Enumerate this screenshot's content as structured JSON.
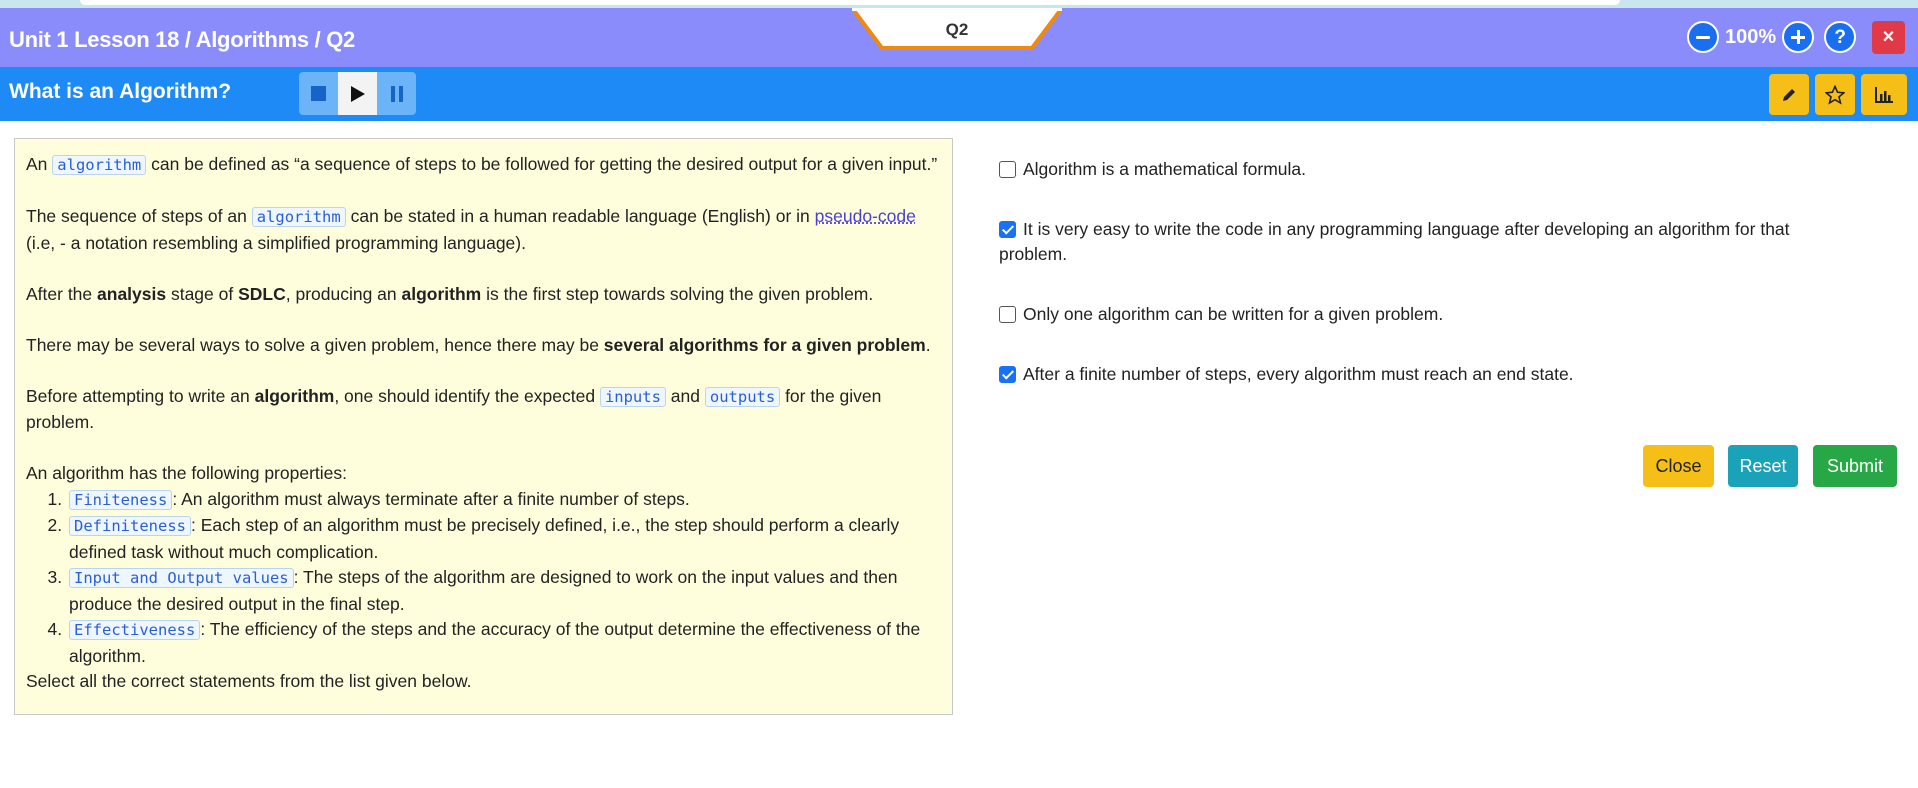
{
  "breadcrumb": "Unit 1 Lesson 18 / Algorithms / Q2",
  "question_tab": "Q2",
  "zoom": {
    "value": "100%",
    "out_icon": "minus-circle-icon",
    "in_icon": "plus-circle-icon"
  },
  "help_label": "?",
  "close_window_label": "×",
  "lesson_title": "What is an Algorithm?",
  "colors": {
    "header_primary": "#8b8cfb",
    "header_secondary": "#1d8af6",
    "tool_button": "#f6bf17",
    "close": "#e03a48",
    "reset": "#1aa2b8",
    "submit": "#27a745"
  },
  "passage": {
    "p1": {
      "before": "An ",
      "code": "algorithm",
      "after": " can be defined as “a sequence of steps to be followed for getting the desired output for a given input.”"
    },
    "p2": {
      "before": "The sequence of steps of an ",
      "code": "algorithm",
      "middle": " can be stated in a human readable language (English) or in ",
      "link": "pseudo-code",
      "after": " (i.e, - a notation resembling a simplified programming language)."
    },
    "p3": {
      "t1": "After the ",
      "b1": "analysis",
      "t2": " stage of ",
      "b2": "SDLC",
      "t3": ", producing an ",
      "b3": "algorithm",
      "t4": " is the first step towards solving the given problem."
    },
    "p4": {
      "t1": "There may be several ways to solve a given problem, hence there may be ",
      "b1": "several algorithms for a given problem",
      "t2": "."
    },
    "p5": {
      "t1": "Before attempting to write an ",
      "b1": "algorithm",
      "t2": ", one should identify the expected ",
      "c1": "inputs",
      "t3": " and ",
      "c2": "outputs",
      "t4": " for the given problem."
    },
    "properties_intro": "An algorithm has the following properties:",
    "properties": [
      {
        "term": "Finiteness",
        "text": ": An algorithm must always terminate after a finite number of steps."
      },
      {
        "term": "Definiteness",
        "text": ": Each step of an algorithm must be precisely defined, i.e., the step should perform a clearly defined task without much complication."
      },
      {
        "term": "Input and Output values",
        "text": ": The steps of the algorithm are designed to work on the input values and then produce the desired output in the final step."
      },
      {
        "term": "Effectiveness",
        "text": ": The efficiency of the steps and the accuracy of the output determine the effectiveness of the algorithm."
      }
    ],
    "instruction": "Select all the correct statements from the list given below."
  },
  "options": [
    {
      "text": "Algorithm is a mathematical formula.",
      "checked": false
    },
    {
      "text": "It is very easy to write the code in any programming language after developing an algorithm for that problem.",
      "checked": true
    },
    {
      "text": "Only one algorithm can be written for a given problem.",
      "checked": false
    },
    {
      "text": "After a finite number of steps, every algorithm must reach an end state.",
      "checked": true
    }
  ],
  "buttons": {
    "close": "Close",
    "reset": "Reset",
    "submit": "Submit"
  }
}
